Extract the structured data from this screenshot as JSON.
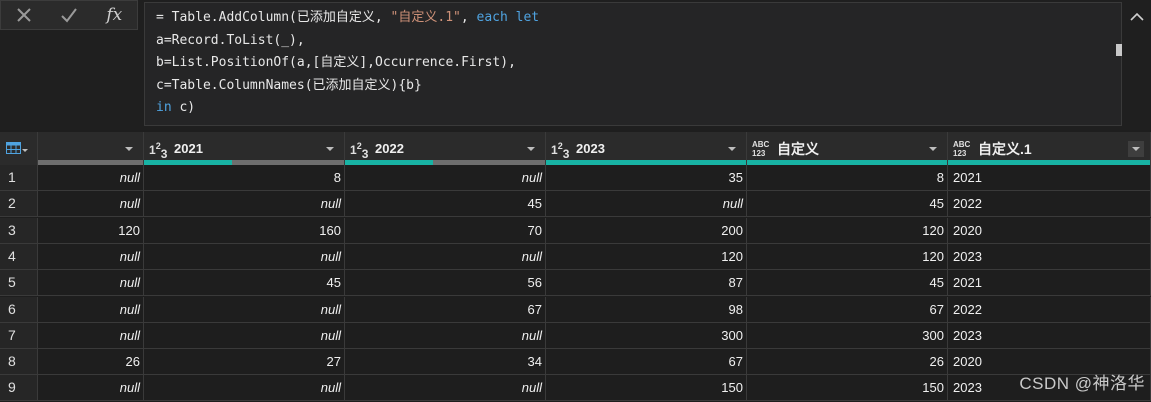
{
  "formula_bar": {
    "cancel_icon": "x-icon",
    "commit_icon": "check-icon",
    "fx_label": "fx",
    "lines": [
      [
        {
          "t": "= Table.AddColumn(已添加自定义, ",
          "c": ""
        },
        {
          "t": "\"自定义.1\"",
          "c": "str"
        },
        {
          "t": ", ",
          "c": ""
        },
        {
          "t": "each let",
          "c": "kw"
        }
      ],
      [
        {
          "t": "a=Record.ToList(_),",
          "c": ""
        }
      ],
      [
        {
          "t": "b=List.PositionOf(a,[自定义],Occurrence.First),",
          "c": ""
        }
      ],
      [
        {
          "t": "c=Table.ColumnNames(已添加自定义){b}",
          "c": ""
        }
      ],
      [
        {
          "t": "in",
          "c": "kw"
        },
        {
          "t": " c)",
          "c": ""
        }
      ]
    ]
  },
  "table": {
    "columns": [
      {
        "name": "",
        "type": "",
        "bar": "grey"
      },
      {
        "name": "2021",
        "type": "num",
        "bar": "grey-teal"
      },
      {
        "name": "2022",
        "type": "num",
        "bar": "grey-teal"
      },
      {
        "name": "2023",
        "type": "num",
        "bar": "teal"
      },
      {
        "name": "自定义",
        "type": "abc",
        "bar": "teal"
      },
      {
        "name": "自定义.1",
        "type": "abc",
        "bar": "teal"
      }
    ],
    "rows": [
      {
        "n": "1",
        "cells": [
          "null",
          "8",
          "null",
          "35",
          "8",
          "2021"
        ]
      },
      {
        "n": "2",
        "cells": [
          "null",
          "null",
          "45",
          "null",
          "45",
          "2022"
        ]
      },
      {
        "n": "3",
        "cells": [
          "120",
          "160",
          "70",
          "200",
          "120",
          "2020"
        ]
      },
      {
        "n": "4",
        "cells": [
          "null",
          "null",
          "null",
          "120",
          "120",
          "2023"
        ]
      },
      {
        "n": "5",
        "cells": [
          "null",
          "45",
          "56",
          "87",
          "45",
          "2021"
        ]
      },
      {
        "n": "6",
        "cells": [
          "null",
          "null",
          "67",
          "98",
          "67",
          "2022"
        ]
      },
      {
        "n": "7",
        "cells": [
          "null",
          "null",
          "null",
          "300",
          "300",
          "2023"
        ]
      },
      {
        "n": "8",
        "cells": [
          "26",
          "27",
          "34",
          "67",
          "26",
          "2020"
        ]
      },
      {
        "n": "9",
        "cells": [
          "null",
          "null",
          "null",
          "150",
          "150",
          "2023"
        ]
      }
    ]
  },
  "colors": {
    "accent": "#18b3a4",
    "keyword": "#4fa3e0",
    "string": "#ce9178"
  },
  "watermark": "CSDN @神洛华"
}
